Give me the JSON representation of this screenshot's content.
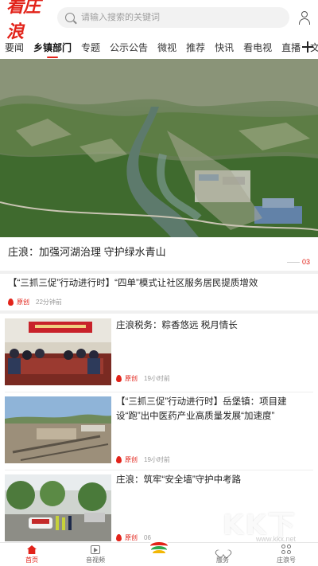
{
  "header": {
    "logo": "看庄浪",
    "search_placeholder": "请输入搜索的关键词"
  },
  "tabs": [
    {
      "label": "要闻"
    },
    {
      "label": "乡镇部门"
    },
    {
      "label": "专题"
    },
    {
      "label": "公示公告"
    },
    {
      "label": "微视"
    },
    {
      "label": "推荐"
    },
    {
      "label": "快讯"
    },
    {
      "label": "看电视"
    },
    {
      "label": "直播"
    },
    {
      "label": "文学"
    }
  ],
  "active_tab": "乡镇部门",
  "hero": {
    "title": "庄浪：加强河湖治理 守护绿水青山",
    "index": "03"
  },
  "top_news": {
    "title": "【“三抓三促”行动进行时】“四单”模式让社区服务居民提质增效",
    "badge": "原创",
    "time": "22分钟前"
  },
  "news_items": [
    {
      "title": "庄浪税务：粽香悠远 税月情长",
      "badge": "原创",
      "time": "19小时前"
    },
    {
      "title": "【“三抓三促”行动进行时】岳堡镇：项目建设“跑”出中医药产业高质量发展“加速度”",
      "badge": "原创",
      "time": "19小时前"
    },
    {
      "title": "庄浪：筑牢“安全墙”守护中考路",
      "badge": "原创",
      "time": "06"
    }
  ],
  "bottom_nav": [
    {
      "label": "首页",
      "icon": "home-icon"
    },
    {
      "label": "音视频",
      "icon": "video-icon"
    },
    {
      "label": "",
      "icon": "app-logo-icon"
    },
    {
      "label": "服务",
      "icon": "heart-icon"
    },
    {
      "label": "庄浪号",
      "icon": "grid-icon"
    }
  ],
  "watermark": {
    "text": "KK下载",
    "url": "www.kkx.net"
  },
  "colors": {
    "accent": "#e2231a",
    "divider": "#f0f0f0"
  }
}
